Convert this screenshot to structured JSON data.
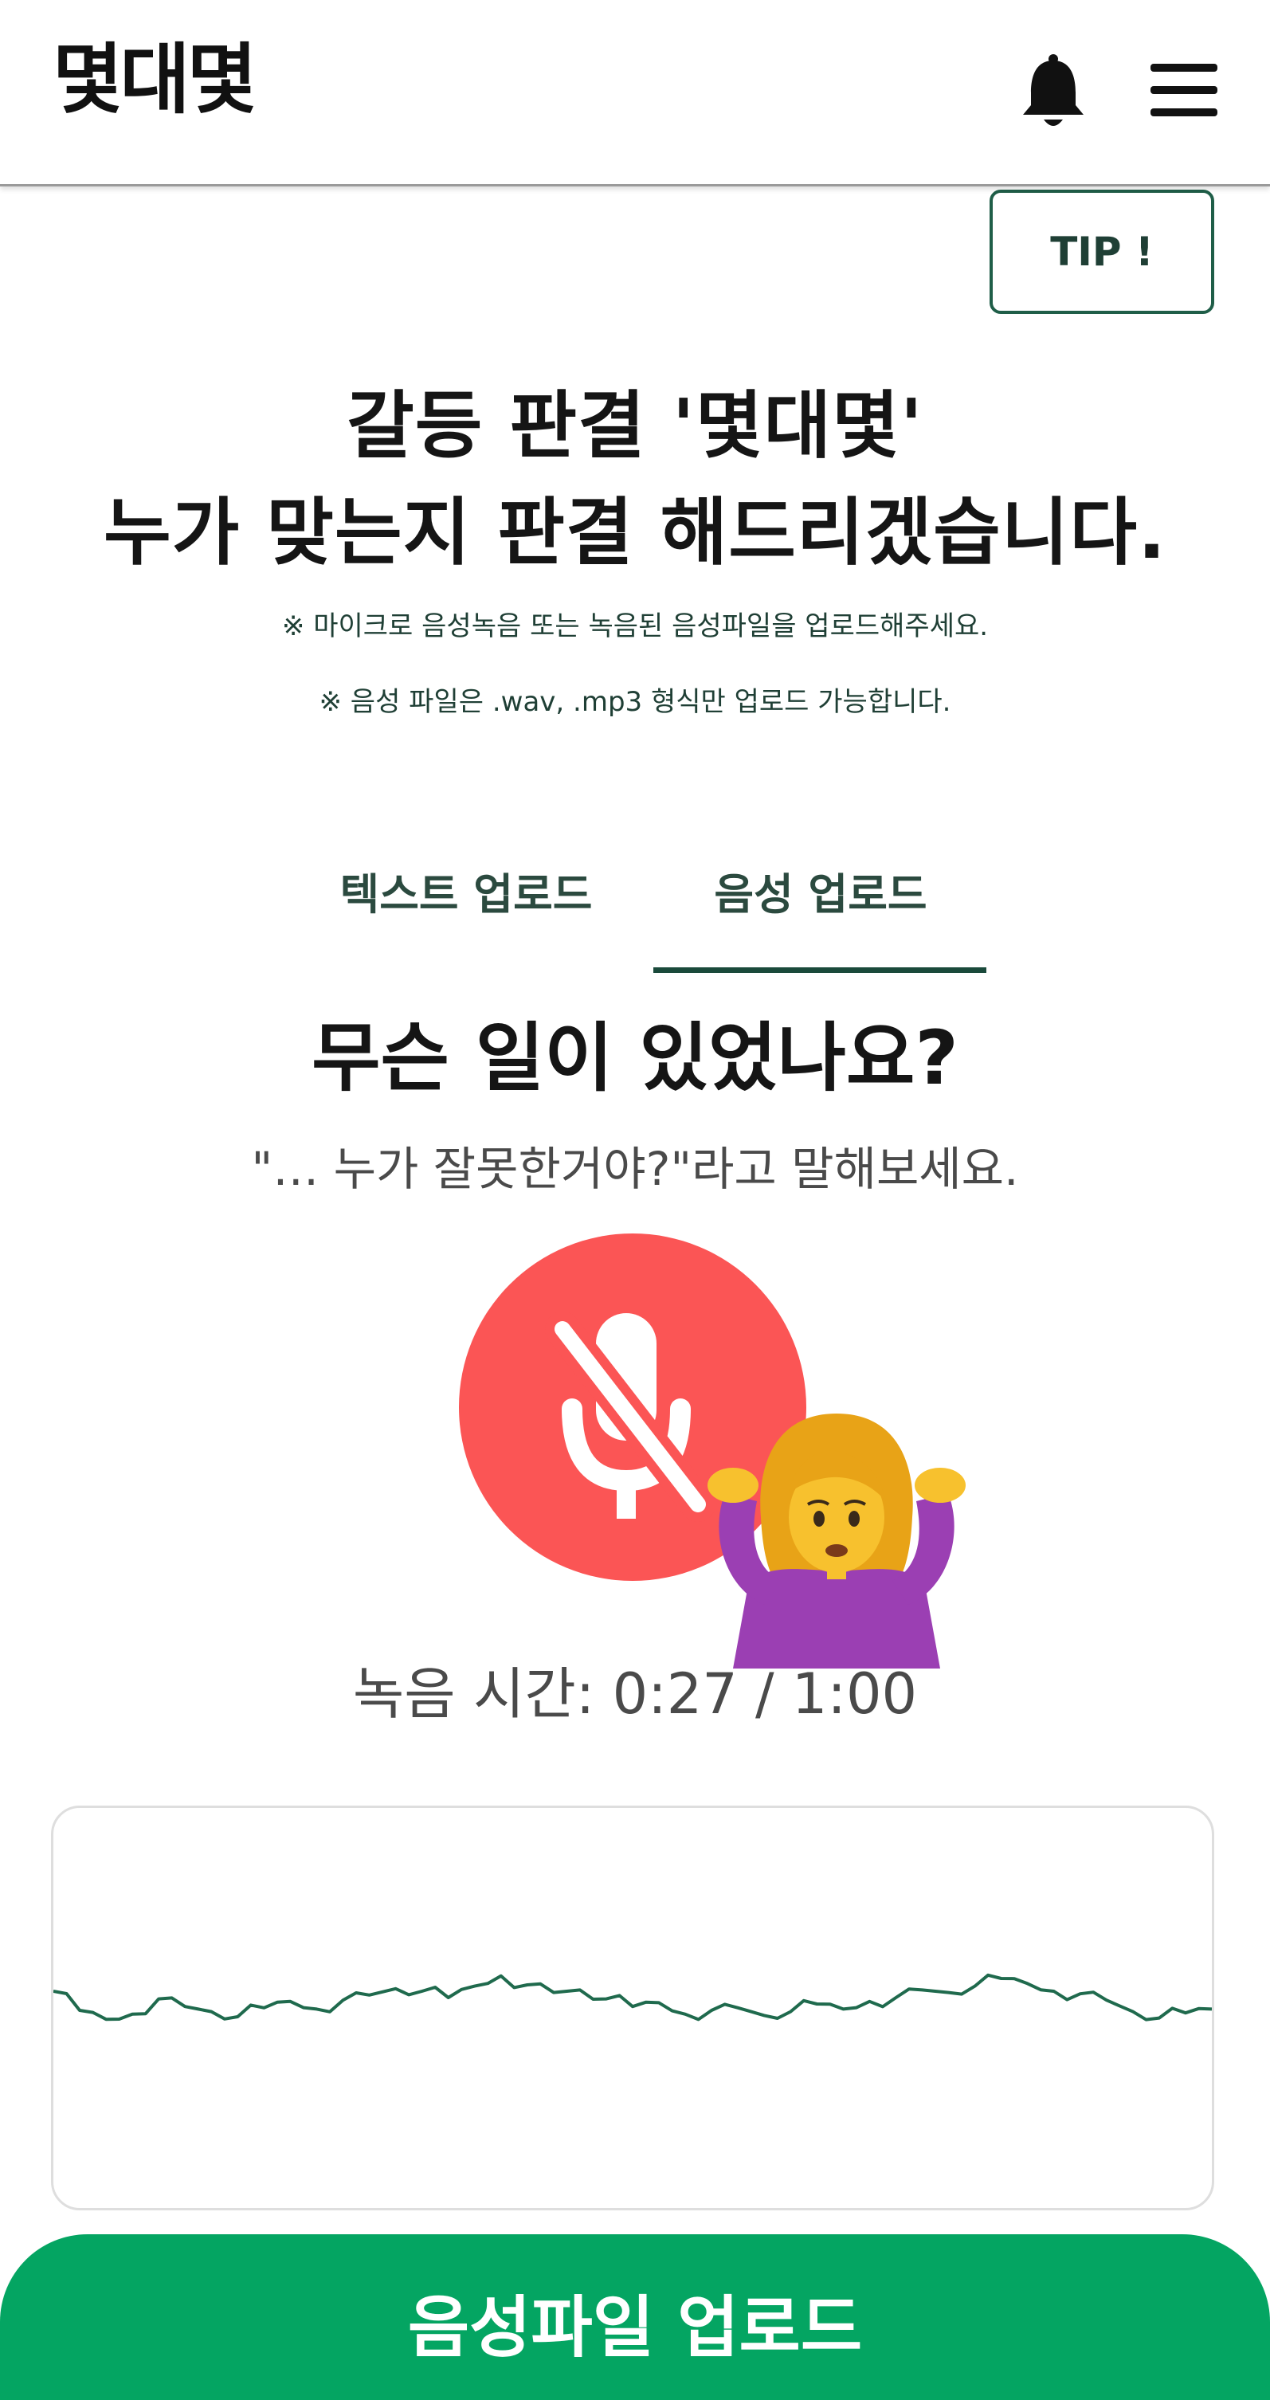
{
  "header": {
    "logo": "몇대몇",
    "bell_icon": "bell-icon",
    "menu_icon": "hamburger-menu-icon"
  },
  "tip_label": "TIP !",
  "headline": {
    "line1": "갈등 판결 '몇대몇'",
    "line2": "누가 맞는지 판결 해드리겠습니다."
  },
  "notices": [
    "※ 마이크로 음성녹음 또는 녹음된 음성파일을 업로드해주세요.",
    "※ 음성 파일은 .wav, .mp3 형식만 업로드 가능합니다."
  ],
  "tabs": [
    {
      "label": "텍스트 업로드",
      "active": false
    },
    {
      "label": "음성 업로드",
      "active": true
    }
  ],
  "question": "무슨 일이 있었나요?",
  "hint": "\"… 누가 잘못한거야?\"라고 말해보세요.",
  "mic": {
    "icon": "microphone-off-icon",
    "state": "muted"
  },
  "emoji": "person-shrugging-emoji",
  "timer": "녹음 시간: 0:27 / 1:00",
  "waveform": {
    "values": [
      0.1,
      -0.05,
      -0.12,
      -0.08,
      0.04,
      -0.02,
      -0.06,
      -0.1,
      -0.03,
      0.02,
      -0.04,
      0.03,
      0.07,
      0.12,
      0.1,
      0.05,
      0.14,
      0.22,
      0.15,
      0.09,
      0.11,
      0.04,
      -0.02,
      0.01,
      -0.08,
      -0.05,
      -0.03,
      -0.09,
      -0.06,
      0.0,
      -0.04,
      0.02,
      0.05,
      0.11,
      0.09,
      0.14,
      0.2,
      0.16,
      0.1,
      0.08,
      0.03,
      -0.06,
      -0.11,
      -0.07,
      -0.04
    ]
  },
  "colors": {
    "accent": "#04a562",
    "dark_green": "#1f5e48",
    "wave": "#1f6a4d",
    "mic": "#fb5555"
  },
  "upload_label": "음성파일 업로드"
}
